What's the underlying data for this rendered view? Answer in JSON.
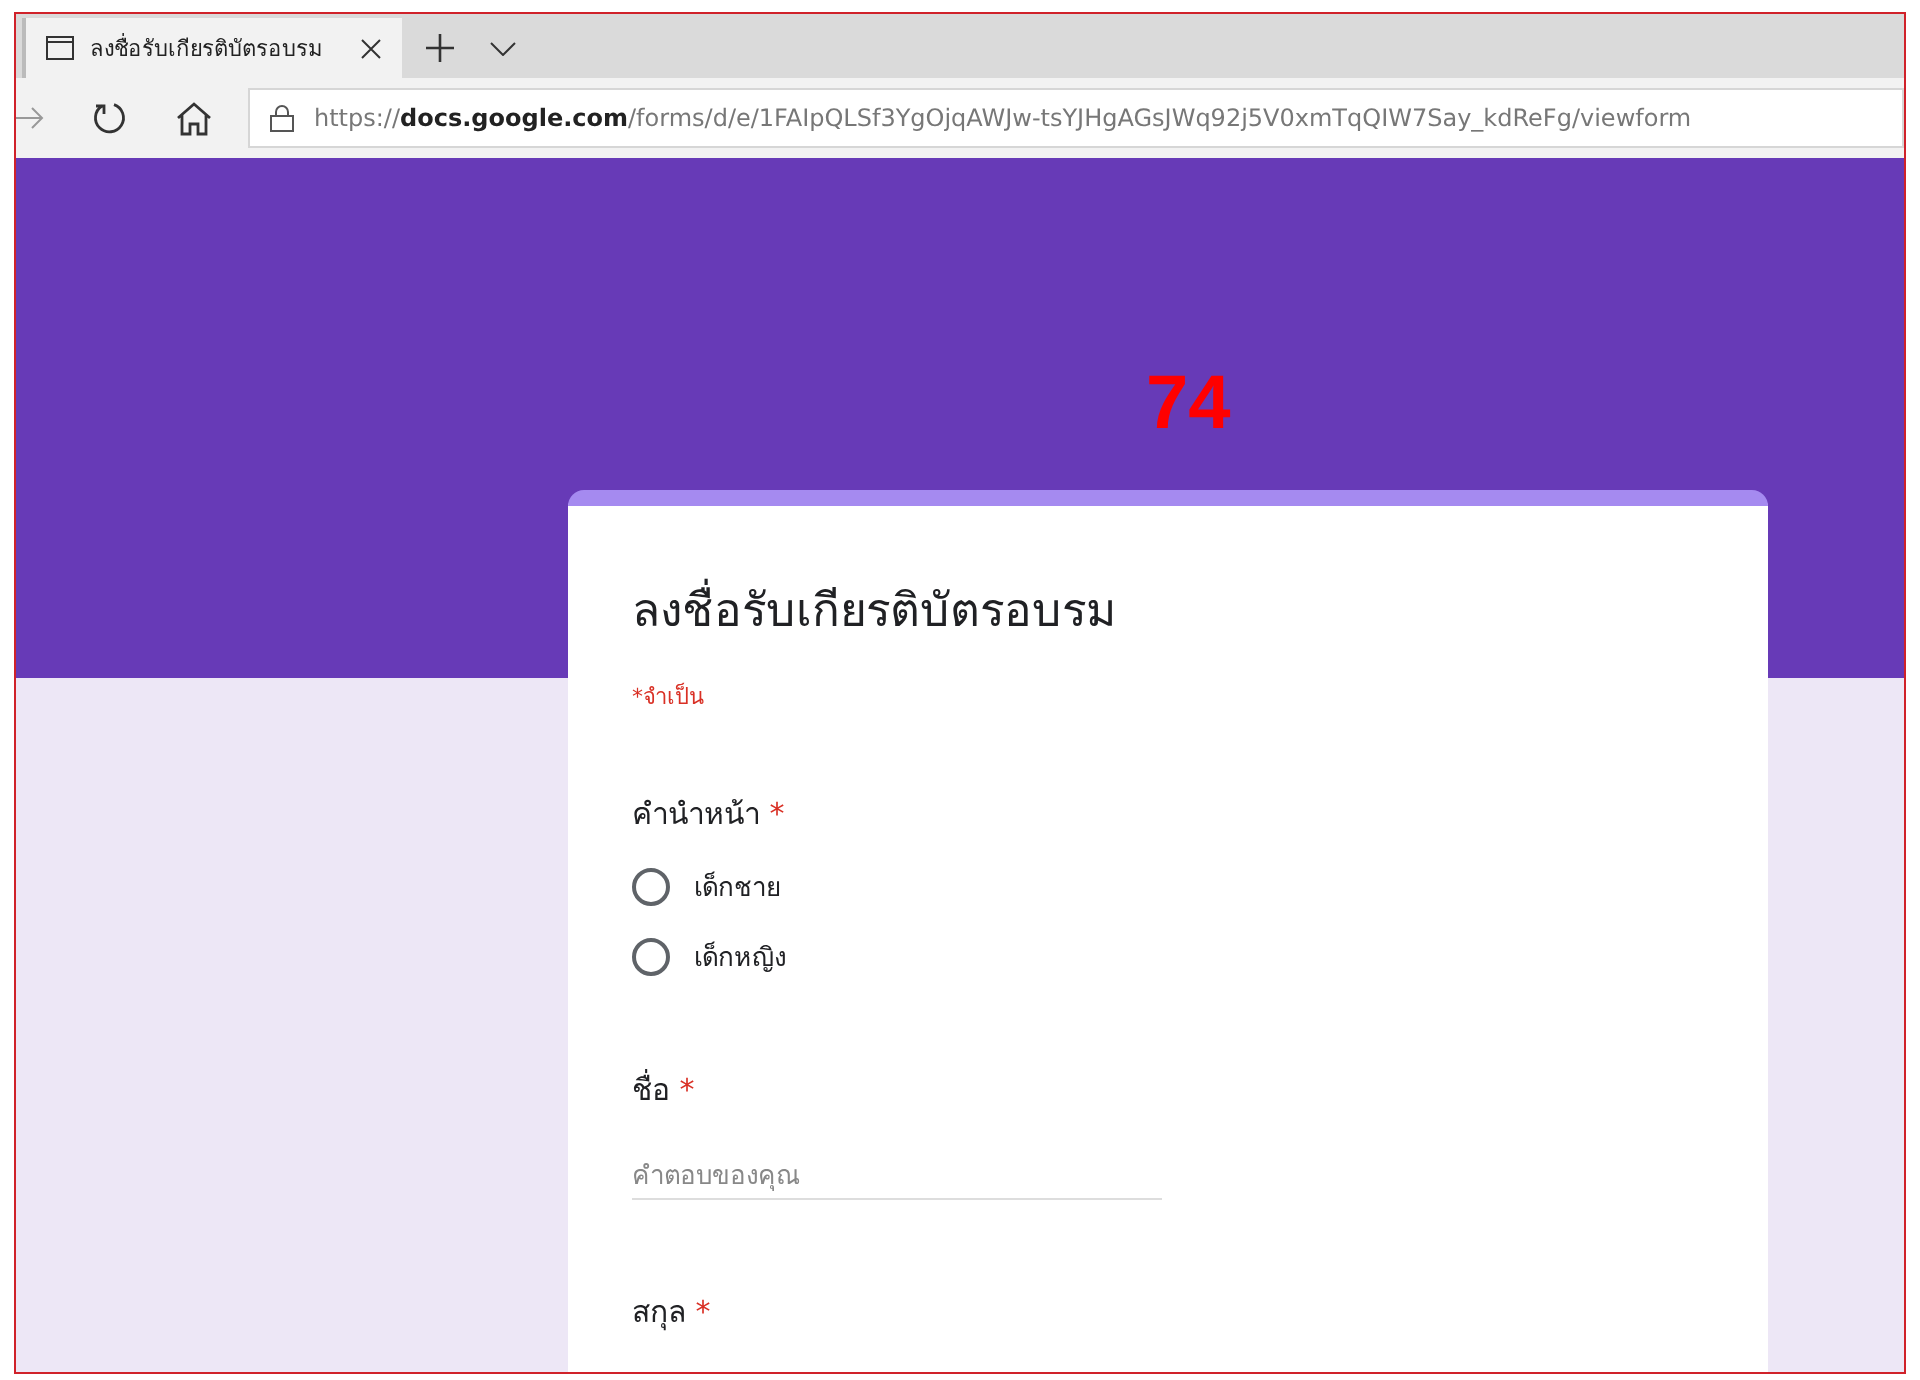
{
  "browser": {
    "tab": {
      "title": "ลงชื่อรับเกียรติบัตรอบรม",
      "selected": true
    },
    "address": {
      "prefix": "https://",
      "host": "docs.google.com",
      "path": "/forms/d/e/1FAIpQLSf3YgOjqAWJw-tsYJHgAGsJWq92j5V0xmTqQIW7Say_kdReFg/viewform"
    }
  },
  "page_number": "74",
  "form": {
    "title": "ลงชื่อรับเกียรติบัตรอบรม",
    "required_note": "*จำเป็น",
    "questions": [
      {
        "kind": "radio",
        "label": "คำนำหน้า",
        "required_mark": "*",
        "options": [
          {
            "label": "เด็กชาย",
            "selected": false
          },
          {
            "label": "เด็กหญิง",
            "selected": false
          }
        ]
      },
      {
        "kind": "text",
        "label": "ชื่อ",
        "required_mark": "*",
        "placeholder": "คำตอบของคุณ"
      },
      {
        "kind": "heading",
        "label": "สกุล",
        "required_mark": "*"
      }
    ]
  }
}
